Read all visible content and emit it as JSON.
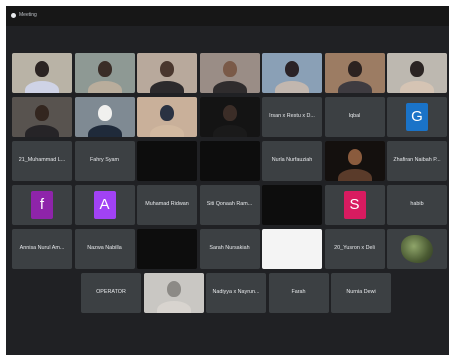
{
  "window": {
    "title": "Meeting",
    "indicator_icon": "recording-dot-icon"
  },
  "colors": {
    "background": "#202124",
    "tile": "#3c4043",
    "text": "#e8eaed"
  },
  "participants": [
    {
      "id": "p01",
      "type": "video",
      "wall": "#b9b3a6",
      "head": "#2b2422",
      "body": "#cfd3e6"
    },
    {
      "id": "p02",
      "type": "video",
      "wall": "#8e9994",
      "head": "#3a2d27",
      "body": "#b9ad9c"
    },
    {
      "id": "p03",
      "type": "video",
      "wall": "#b8a99c",
      "head": "#4a372e",
      "body": "#2c2a2c"
    },
    {
      "id": "p04",
      "type": "video",
      "wall": "#9a8d86",
      "head": "#7a5a48",
      "body": "#2f2c2d"
    },
    {
      "id": "p05",
      "type": "video",
      "wall": "#8aa0b6",
      "head": "#2a2226",
      "body": "#c2b7af"
    },
    {
      "id": "p06",
      "type": "video",
      "wall": "#9c7c63",
      "head": "#2c2220",
      "body": "#3e3b40"
    },
    {
      "id": "p07",
      "type": "video",
      "wall": "#bdb8b0",
      "head": "#2b2423",
      "body": "#d5c4b4"
    },
    {
      "id": "p08",
      "type": "video",
      "wall": "#58534f",
      "head": "#33261f",
      "body": "#262427"
    },
    {
      "id": "p09",
      "type": "video",
      "wall": "#7f8a93",
      "head": "#f0f0ee",
      "body": "#1f2a3a"
    },
    {
      "id": "p10",
      "type": "video",
      "wall": "#c9b09a",
      "head": "#2a3242",
      "body": "#d2b9a0"
    },
    {
      "id": "p11",
      "type": "video",
      "wall": "#141414",
      "head": "#3b2d27",
      "body": "#1a1a1a"
    },
    {
      "id": "p12",
      "type": "name",
      "name": "Irsan x  Restu x D..."
    },
    {
      "id": "p13",
      "type": "name",
      "name": "Iqbal"
    },
    {
      "id": "p14",
      "type": "letter",
      "letter": "G",
      "color": "#1a73c8"
    },
    {
      "id": "p15",
      "type": "name",
      "name": "21_Muhammad L..."
    },
    {
      "id": "p16",
      "type": "name",
      "name": "Fahry Syam"
    },
    {
      "id": "p17",
      "type": "black"
    },
    {
      "id": "p18",
      "type": "black"
    },
    {
      "id": "p19",
      "type": "name",
      "name": "Nurla Nurfauziah"
    },
    {
      "id": "p20",
      "type": "video",
      "wall": "#14100e",
      "head": "#8a5b3d",
      "body": "#5a3b2a"
    },
    {
      "id": "p21",
      "type": "name",
      "name": "Zhafiran Naibah P..."
    },
    {
      "id": "p22",
      "type": "letter",
      "letter": "f",
      "color": "#8e24aa"
    },
    {
      "id": "p23",
      "type": "letter",
      "letter": "A",
      "color": "#a142f4"
    },
    {
      "id": "p24",
      "type": "name",
      "name": "Muhamad Ridwan"
    },
    {
      "id": "p25",
      "type": "name",
      "name": "Siti Qonaah Ram..."
    },
    {
      "id": "p26",
      "type": "black"
    },
    {
      "id": "p27",
      "type": "letter",
      "letter": "S",
      "color": "#d81b60"
    },
    {
      "id": "p28",
      "type": "name",
      "name": "habib"
    },
    {
      "id": "p29",
      "type": "name",
      "name": "Annisa Nurul Am..."
    },
    {
      "id": "p30",
      "type": "name",
      "name": "Nazwa Nabilla"
    },
    {
      "id": "p31",
      "type": "black"
    },
    {
      "id": "p32",
      "type": "name",
      "name": "Sarah Nursakiah"
    },
    {
      "id": "p33",
      "type": "white"
    },
    {
      "id": "p34",
      "type": "name",
      "name": "20_Yusron x Deli"
    },
    {
      "id": "p35",
      "type": "plant"
    },
    {
      "id": "p36",
      "type": "name",
      "name": "OPERATOR"
    },
    {
      "id": "p37",
      "type": "video",
      "wall": "#c9c7c3",
      "head": "#8c8a86",
      "body": "#d8d4cf"
    },
    {
      "id": "p38",
      "type": "name",
      "name": "Nadiyya x Nayrun..."
    },
    {
      "id": "p39",
      "type": "name",
      "name": "Farah"
    },
    {
      "id": "p40",
      "type": "name",
      "name": "Nurnia Dewi"
    }
  ]
}
